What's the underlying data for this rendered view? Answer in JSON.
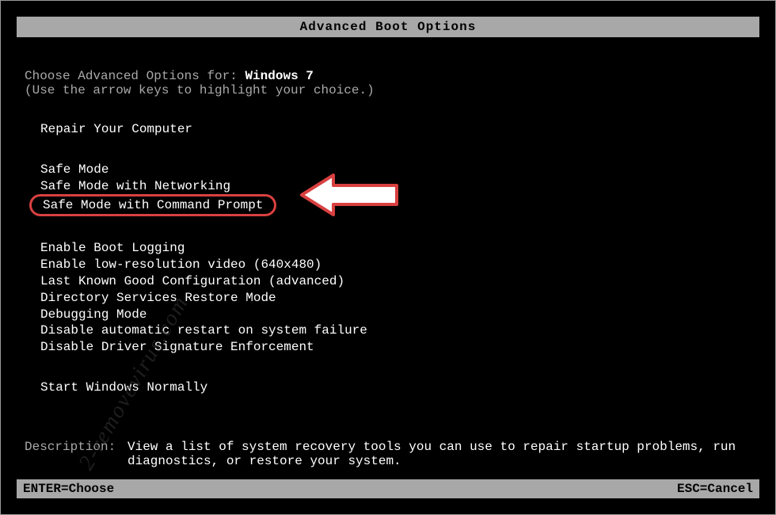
{
  "title": "Advanced Boot Options",
  "intro": {
    "prefix": "Choose Advanced Options for: ",
    "os": "Windows 7",
    "hint": "(Use the arrow keys to highlight your choice.)"
  },
  "menu": {
    "repair": "Repair Your Computer",
    "safe_mode": "Safe Mode",
    "safe_mode_net": "Safe Mode with Networking",
    "safe_mode_cmd": "Safe Mode with Command Prompt",
    "boot_logging": "Enable Boot Logging",
    "low_res": "Enable low-resolution video (640x480)",
    "last_known": "Last Known Good Configuration (advanced)",
    "ds_restore": "Directory Services Restore Mode",
    "debugging": "Debugging Mode",
    "disable_restart": "Disable automatic restart on system failure",
    "disable_driver_sig": "Disable Driver Signature Enforcement",
    "start_normally": "Start Windows Normally"
  },
  "description": {
    "label": "Description:",
    "text": "View a list of system recovery tools you can use to repair startup problems, run diagnostics, or restore your system."
  },
  "footer": {
    "enter": "ENTER=Choose",
    "esc": "ESC=Cancel"
  },
  "watermark": "2-removevirus.com",
  "colors": {
    "highlight_border": "#d94040",
    "bar_bg": "#a8a8a8",
    "text_bright": "#ffffff",
    "text_dim": "#a8a8a8",
    "bg": "#000000"
  }
}
